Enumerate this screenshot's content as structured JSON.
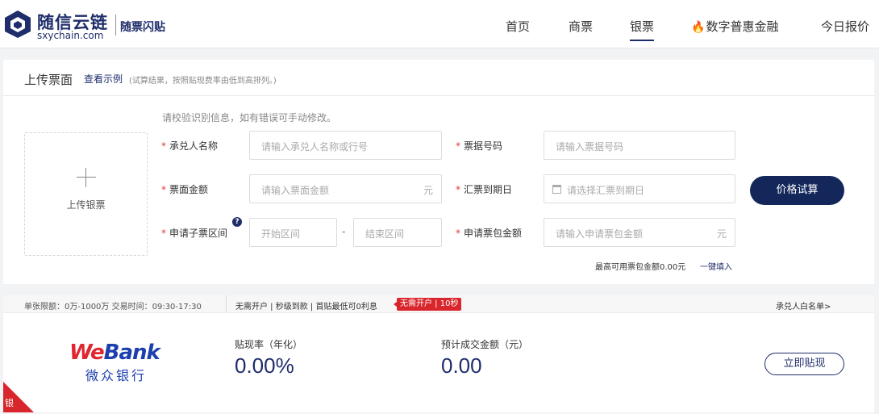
{
  "header": {
    "brand_cn": "随信云链",
    "brand_en": "sxychain.com",
    "brand_sub": "随票闪贴",
    "nav": [
      {
        "label": "首页",
        "active": false
      },
      {
        "label": "商票",
        "active": false
      },
      {
        "label": "银票",
        "active": true
      },
      {
        "label": "数字普惠金融",
        "active": false,
        "icon": "fire-icon"
      },
      {
        "label": "今日报价",
        "active": false
      }
    ]
  },
  "upload_card": {
    "title": "上传票面",
    "example_link": "查看示例",
    "note": "(试算结果，按照贴现费率由低到高排列。)",
    "upload_label": "上传银票",
    "hint": "请校验识别信息，如有错误可手动修改。",
    "fields": {
      "acceptor": {
        "label": "承兑人名称",
        "placeholder": "请输入承兑人名称或行号"
      },
      "bill_no": {
        "label": "票据号码",
        "placeholder": "请输入票据号码"
      },
      "amount": {
        "label": "票面金额",
        "placeholder": "请输入票面金额",
        "unit": "元"
      },
      "due_date": {
        "label": "汇票到期日",
        "placeholder": "请选择汇票到期日"
      },
      "sub_range": {
        "label": "申请子票区间",
        "start_placeholder": "开始区间",
        "end_placeholder": "结束区间",
        "separator": "-"
      },
      "package_amount": {
        "label": "申请票包金额",
        "placeholder": "请输入申请票包金额",
        "unit": "元"
      }
    },
    "calc_button": "价格试算",
    "max_amount_text": "最高可用票包金额0.00元",
    "fill_all": "一键填入"
  },
  "bank_card": {
    "limit_text": "单张限额：0万-1000万  交易时间：09:30-17:30",
    "tags_text": "无需开户 | 秒级到款 | 首贴最低可0利息",
    "badge": "无需开户 | 10秒",
    "whitelist": "承兑人白名单>",
    "bank_logo_en_we": "We",
    "bank_logo_en_bank": "Bank",
    "bank_logo_cn": "微众银行",
    "rate_label": "贴现率（年化）",
    "rate_value": "0.00%",
    "amount_label": "预计成交金额（元）",
    "amount_value": "0.00",
    "action_button": "立即贴现",
    "corner_tag": "银"
  },
  "colors": {
    "brand": "#1f2d6b",
    "primary_button": "#13275a",
    "red": "#d8262c"
  }
}
